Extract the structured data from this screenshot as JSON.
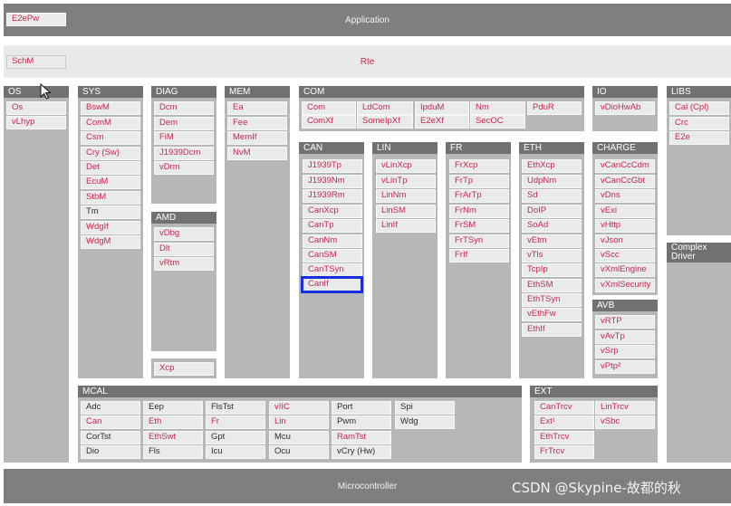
{
  "top": {
    "application": "Application",
    "e2epw": "E2ePw"
  },
  "rte": {
    "label": "Rte",
    "schm": "SchM"
  },
  "micro": "Microcontroller",
  "watermark": "CSDN @Skypine-故都的秋",
  "groups": {
    "os": {
      "title": "OS",
      "items": [
        "Os",
        "vLhyp"
      ]
    },
    "sys": {
      "title": "SYS",
      "items": [
        "BswM",
        "ComM",
        "Csm",
        "Cry (Sw)",
        "Det",
        "EcuM",
        "StbM",
        "Tm",
        "WdgIf",
        "WdgM"
      ]
    },
    "diag": {
      "title": "DIAG",
      "items": [
        "Dcm",
        "Dem",
        "FiM",
        "J1939Dcm",
        "vDrm"
      ]
    },
    "amd": {
      "title": "AMD",
      "items": [
        "vDbg",
        "Dlt",
        "vRtm"
      ]
    },
    "xcp": "Xcp",
    "mem": {
      "title": "MEM",
      "items": [
        "Ea",
        "Fee",
        "MemIf",
        "NvM"
      ]
    },
    "com": {
      "title": "COM",
      "row1": [
        "Com",
        "LdCom",
        "IpduM",
        "Nm",
        "PduR"
      ],
      "row2": [
        "ComXf",
        "SomeIpXf",
        "E2eXf",
        "SecOC"
      ]
    },
    "can": {
      "title": "CAN",
      "items": [
        "J1939Tp",
        "J1939Nm",
        "J1939Rm",
        "CanXcp",
        "CanTp",
        "CanNm",
        "CanSM",
        "CanTSyn",
        "CanIf"
      ]
    },
    "lin": {
      "title": "LIN",
      "items": [
        "vLinXcp",
        "vLinTp",
        "LinNm",
        "LinSM",
        "LinIf"
      ]
    },
    "fr": {
      "title": "FR",
      "items": [
        "FrXcp",
        "FrTp",
        "FrArTp",
        "FrNm",
        "FrSM",
        "FrTSyn",
        "FrIf"
      ]
    },
    "eth": {
      "title": "ETH",
      "items": [
        "EthXcp",
        "UdpNm",
        "Sd",
        "DoIP",
        "SoAd",
        "vEtm",
        "vTls",
        "TcpIp",
        "EthSM",
        "EthTSyn",
        "vEthFw",
        "EthIf"
      ]
    },
    "io": {
      "title": "IO",
      "items": [
        "vDioHwAb"
      ]
    },
    "charge": {
      "title": "CHARGE",
      "items": [
        "vCanCcCdm",
        "vCanCcGbt",
        "vDns",
        "vExi",
        "vHttp",
        "vJson",
        "vScc",
        "vXmlEngine",
        "vXmlSecurity"
      ]
    },
    "avb": {
      "title": "AVB",
      "items": [
        "vRTP",
        "vAvTp",
        "vSrp",
        "vPtp²"
      ]
    },
    "libs": {
      "title": "LIBS",
      "items": [
        "Cal (Cpl)",
        "Crc",
        "E2e"
      ]
    },
    "cdd": {
      "title": "Complex Driver"
    },
    "mcal": {
      "title": "MCAL",
      "cols": [
        [
          "Adc",
          "Can",
          "CorTst",
          "Dio"
        ],
        [
          "Eep",
          "Eth",
          "EthSwt",
          "Fls"
        ],
        [
          "FlsTst",
          "Fr",
          "Gpt",
          "Icu"
        ],
        [
          "vIIC",
          "Lin",
          "Mcu",
          "Ocu"
        ],
        [
          "Port",
          "Pwm",
          "RamTst",
          "vCry (Hw)"
        ],
        [
          "Spi",
          "Wdg"
        ]
      ]
    },
    "ext": {
      "title": "EXT",
      "cols": [
        [
          "CanTrcv",
          "Ext¹",
          "EthTrcv",
          "FrTrcv"
        ],
        [
          "LinTrcv",
          "vSbc"
        ]
      ]
    }
  },
  "highlight": "CanIf",
  "colors": {
    "module_text": "#c8284f",
    "highlight_border": "#1a2edc",
    "header_bg": "#6f7173",
    "group_bg": "#b6b7b9"
  }
}
